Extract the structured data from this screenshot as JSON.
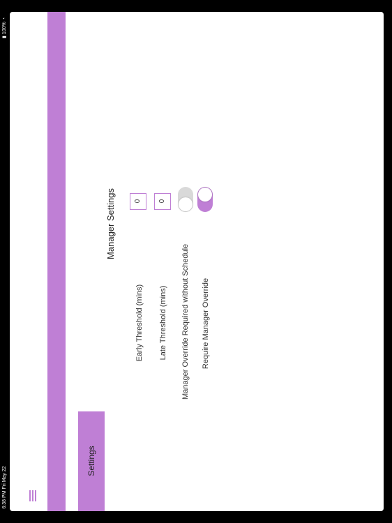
{
  "status_bar": {
    "time_date": "6:38 PM   Fri May 22",
    "battery": "100%"
  },
  "nav_bar": {
    "title": "Settings"
  },
  "sidebar": {
    "items": [
      {
        "label": "Settings",
        "selected": true
      }
    ]
  },
  "manager_settings": {
    "heading": "Manager Settings",
    "early_threshold": {
      "label": "Early Threshold (mins)",
      "value": "0"
    },
    "late_threshold": {
      "label": "Late Threshold (mins)",
      "value": "0"
    },
    "override_without_schedule": {
      "label": "Manager Override Required without Schedule",
      "on": false
    },
    "require_manager_override": {
      "label": "Require Manager Override",
      "on": true
    }
  },
  "colors": {
    "accent": "#bf7fd5",
    "toggle_off": "#d9d9d9",
    "background": "#ffffff"
  }
}
